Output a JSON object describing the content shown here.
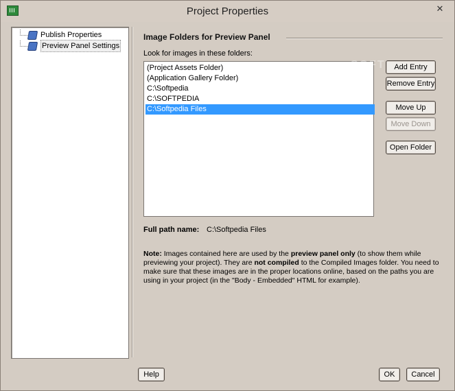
{
  "window": {
    "title": "Project Properties",
    "close_glyph": "✕"
  },
  "tree": {
    "items": [
      {
        "label": "Publish Properties",
        "icon": "page-icon",
        "selected": false
      },
      {
        "label": "Preview Panel Settings",
        "icon": "page-icon",
        "selected": true
      }
    ]
  },
  "panel": {
    "heading": "Image Folders for Preview Panel",
    "list_caption": "Look for images in these folders:",
    "folders": [
      {
        "path": "(Project Assets Folder)",
        "selected": false
      },
      {
        "path": "(Application Gallery Folder)",
        "selected": false
      },
      {
        "path": "C:\\Softpedia",
        "selected": false
      },
      {
        "path": "C:\\SOFTPEDIA",
        "selected": false
      },
      {
        "path": "C:\\Softpedia Files",
        "selected": true
      }
    ],
    "buttons": {
      "add_entry": "Add Entry",
      "remove_entry": "Remove Entry",
      "move_up": "Move Up",
      "move_down": "Move Down",
      "open_folder": "Open Folder"
    },
    "full_path_label": "Full path name:",
    "full_path_value": "C:\\Softpedia Files",
    "note": {
      "p1": "Note:",
      "p2": " Images contained here are used by the ",
      "p3": "preview panel only",
      "p4": " (to show them while previewing your project). They are ",
      "p5": "not compiled",
      "p6": " to the Compiled Images folder. You need to make sure that these images are in the proper locations online, based on the paths you are using in your project (in the \"Body - Embedded\" HTML for example)."
    }
  },
  "footer": {
    "help": "Help",
    "ok": "OK",
    "cancel": "Cancel"
  },
  "watermark": "SOFTPEDIA",
  "colors": {
    "selection": "#3399ff",
    "background": "#d4ccc3"
  }
}
